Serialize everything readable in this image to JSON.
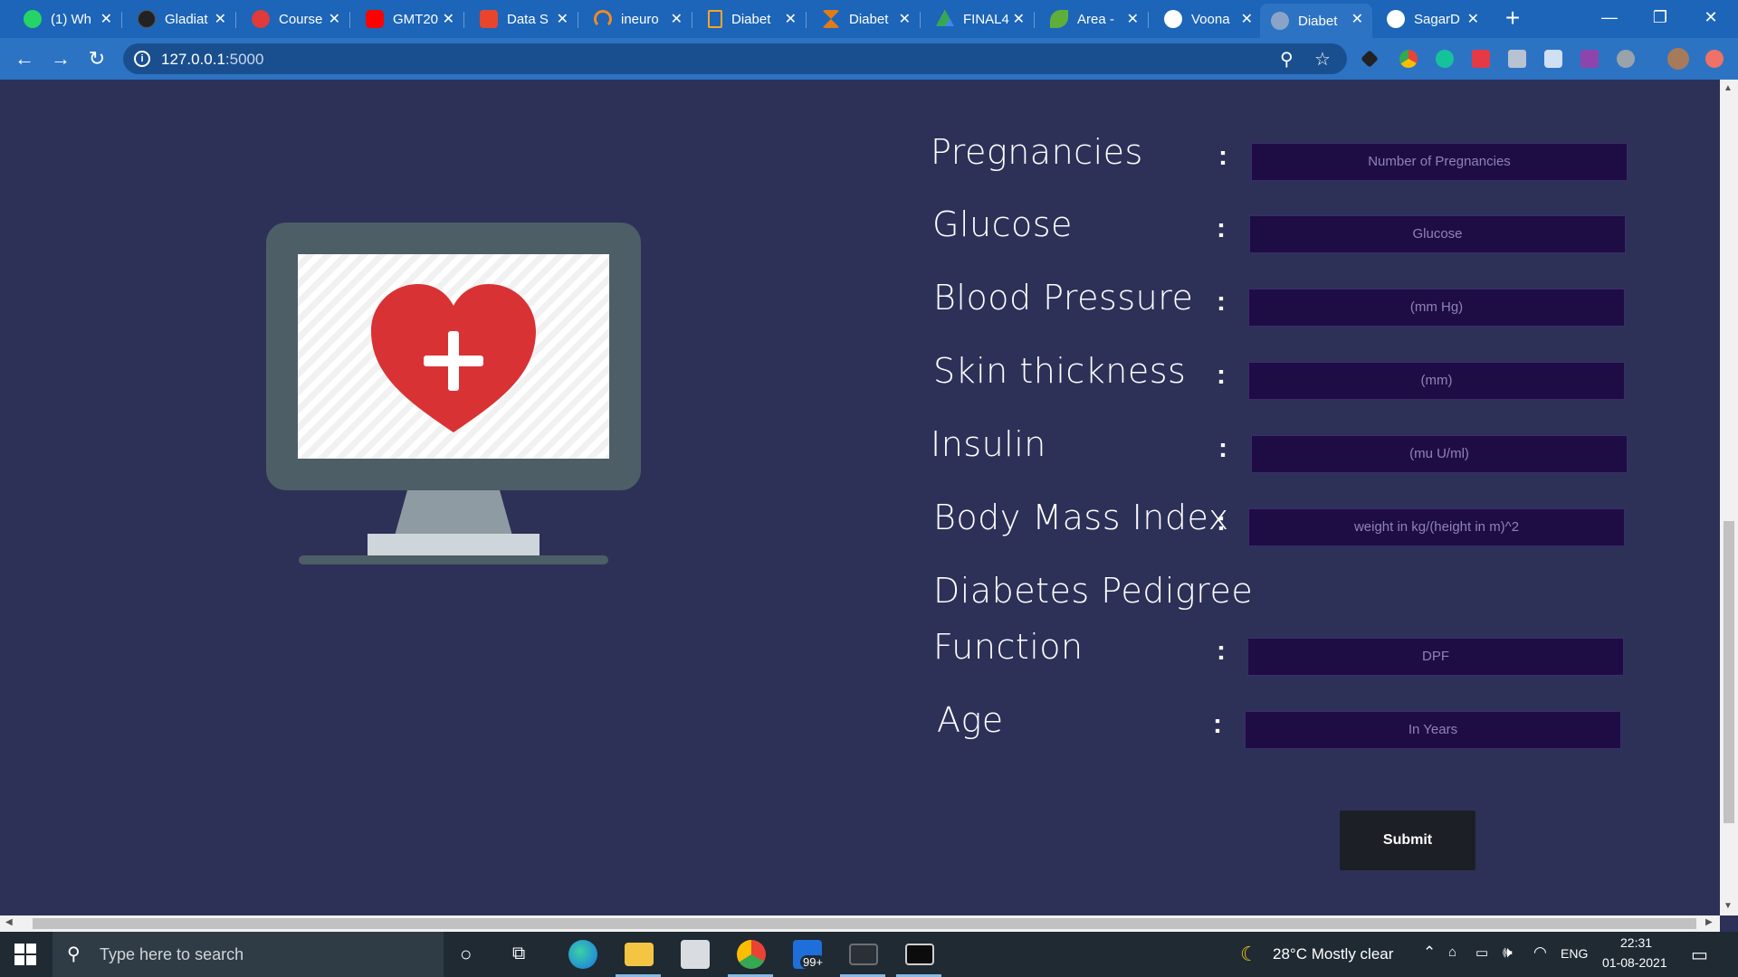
{
  "browser": {
    "tabs": [
      {
        "title": "(1) Wh",
        "color": "#25d366"
      },
      {
        "title": "Gladiat",
        "color": "#222222"
      },
      {
        "title": "Course",
        "color": "#e03a3a"
      },
      {
        "title": "GMT20",
        "color": "#ff0000"
      },
      {
        "title": "Data S",
        "color": "#e8452c"
      },
      {
        "title": "ineuro",
        "color": "#f08a24"
      },
      {
        "title": "Diabet",
        "color": "#f5a623"
      },
      {
        "title": "Diabet",
        "color": "#e07b1a"
      },
      {
        "title": "FINAL4",
        "color": "#34a853"
      },
      {
        "title": "Area -",
        "color": "#5fae3a"
      },
      {
        "title": "Voona",
        "color": "#ffffff"
      },
      {
        "title": "Diabet",
        "color": "#8aa4c8",
        "active": true
      },
      {
        "title": "SagarD",
        "color": "#ffffff"
      }
    ],
    "url_host": "127.0.0.1",
    "url_port": ":5000",
    "extensions": [
      "vpn-icon",
      "chrome-icon",
      "grammarly-icon",
      "sale-off-icon",
      "r-icon",
      "screen-icon",
      "badge-2-icon",
      "moon-icon",
      "avatar",
      "update-icon"
    ]
  },
  "form": {
    "fields": [
      {
        "label": "Pregnancies",
        "placeholder": "Number of Pregnancies"
      },
      {
        "label": "Glucose",
        "placeholder": "Glucose"
      },
      {
        "label": "Blood Pressure",
        "placeholder": "(mm Hg)"
      },
      {
        "label": "Skin thickness",
        "placeholder": "(mm)"
      },
      {
        "label": "Insulin",
        "placeholder": "(mu U/ml)"
      },
      {
        "label": "Body Mass Index",
        "placeholder": "weight in kg/(height in m)^2"
      },
      {
        "label_line1": "Diabetes Pedigree",
        "label_line2": "Function",
        "placeholder": "DPF"
      },
      {
        "label": "Age",
        "placeholder": "In Years"
      }
    ],
    "colon": ":",
    "submit_label": "Submit"
  },
  "illustration": {
    "monitor_color": "#4d5e67",
    "screen_color": "#ffffff",
    "heart_color": "#d93234"
  },
  "taskbar": {
    "search_placeholder": "Type here to search",
    "mail_badge": "99+",
    "weather": "28°C  Mostly clear",
    "language": "ENG",
    "time": "22:31",
    "date": "01-08-2021"
  }
}
